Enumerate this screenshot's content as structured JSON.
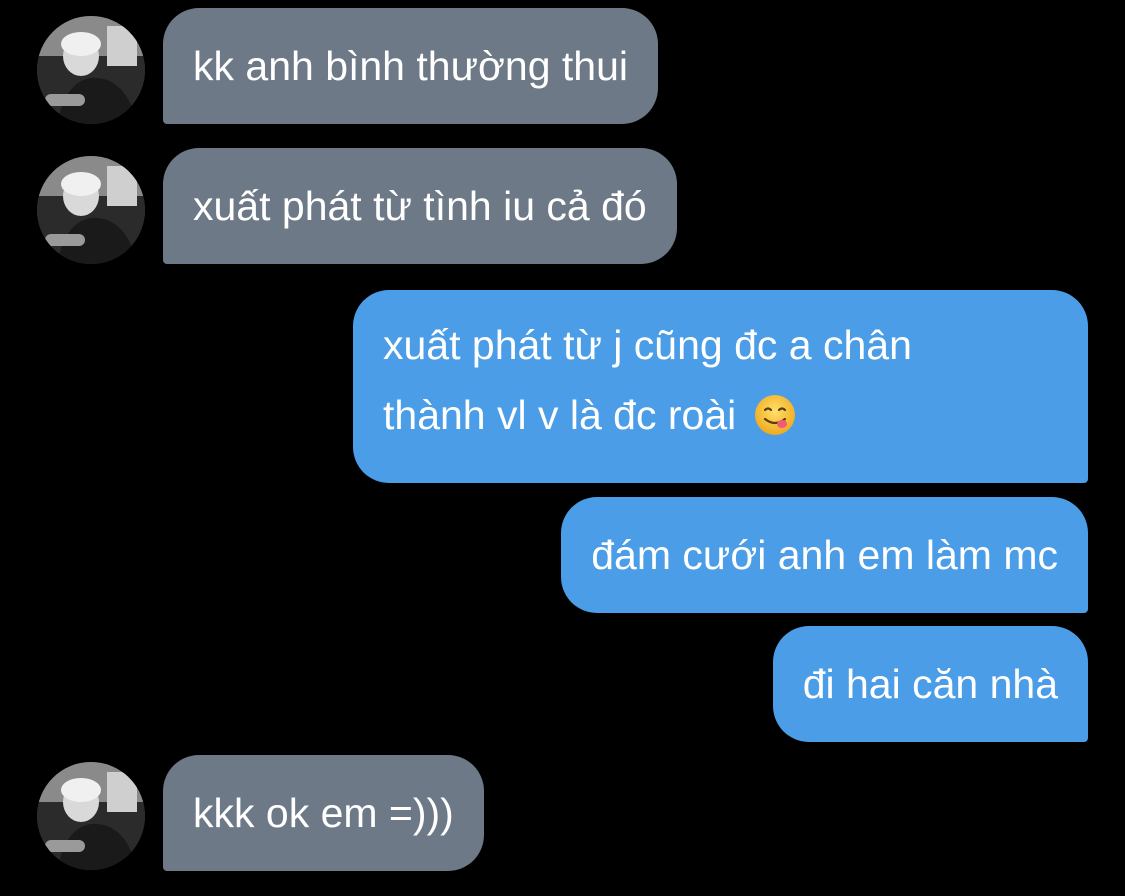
{
  "conversation": {
    "messages": [
      {
        "sender": "other",
        "text": "kk anh bình thường thui"
      },
      {
        "sender": "other",
        "text": "xuất phát từ tình iu cả đó"
      },
      {
        "sender": "me",
        "line1": "xuất phát từ j cũng đc a chân",
        "line2": "thành vl v là đc roài",
        "emoji": "yum-face-emoji"
      },
      {
        "sender": "me",
        "text": "đám cưới anh em làm mc"
      },
      {
        "sender": "me",
        "text": "đi hai căn nhà"
      },
      {
        "sender": "other",
        "text": "kkk ok em =)))"
      }
    ]
  },
  "colors": {
    "background": "#000000",
    "incoming_bubble": "#6d7987",
    "outgoing_bubble": "#4a9de6",
    "text": "#ffffff"
  }
}
